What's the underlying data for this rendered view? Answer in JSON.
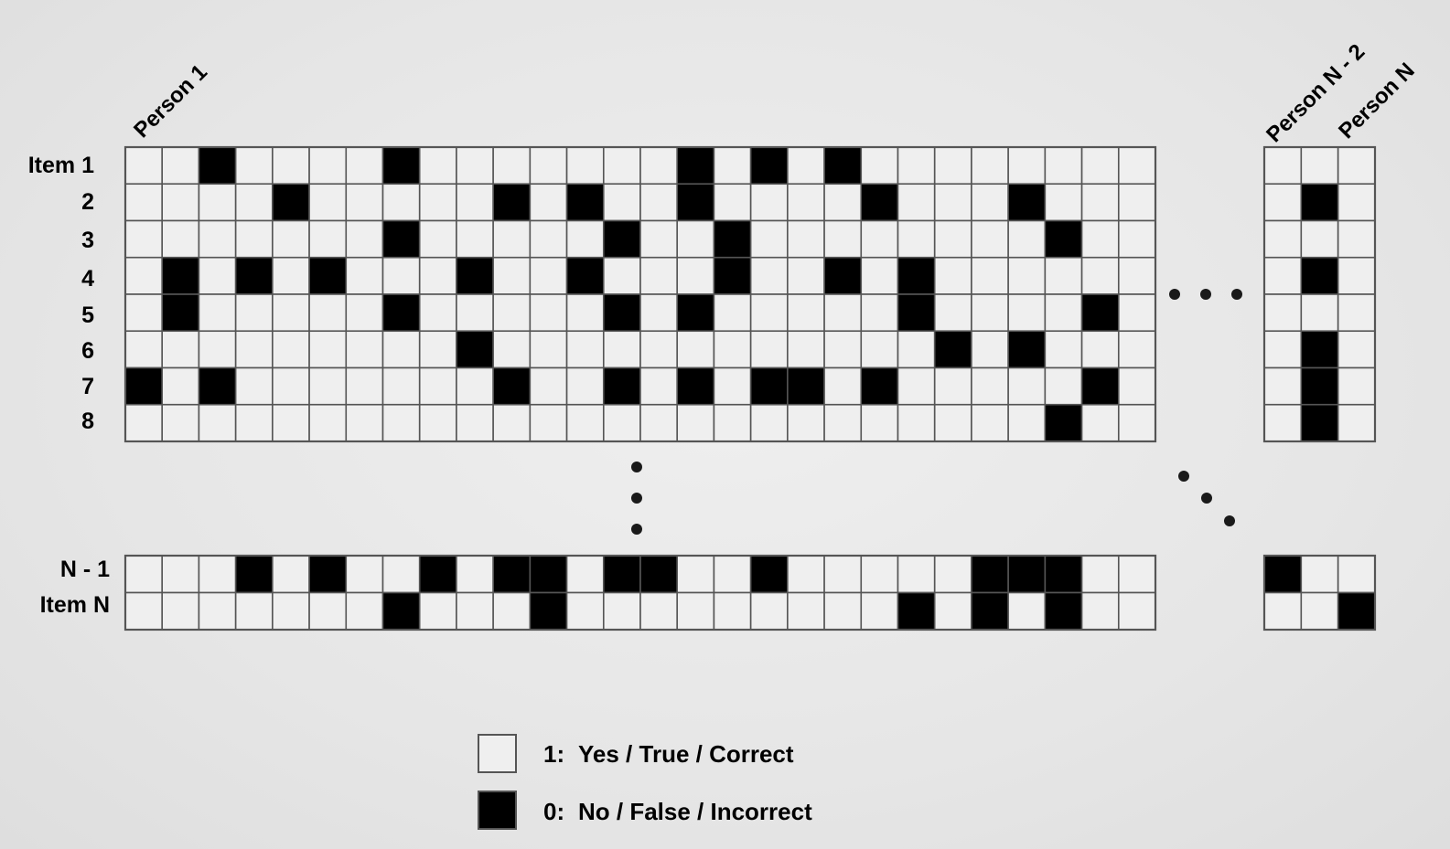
{
  "colors": {
    "cell_one": "#efefef",
    "cell_zero": "#000000",
    "grid_line": "#555555",
    "dot": "#1a1a1a"
  },
  "column_labels": {
    "first": "Person 1",
    "second_last": "Person N - 2",
    "last": "Person N"
  },
  "row_labels": [
    "Item 1",
    "2",
    "3",
    "4",
    "5",
    "6",
    "7",
    "8"
  ],
  "bottom_row_labels": [
    "N - 1",
    "Item N"
  ],
  "matrix": {
    "main_top": [
      [
        1,
        1,
        0,
        1,
        1,
        1,
        1,
        0,
        1,
        1,
        1,
        1,
        1,
        1,
        1,
        0,
        1,
        0,
        1,
        0,
        1,
        1,
        1,
        1,
        1,
        1,
        1,
        1
      ],
      [
        1,
        1,
        1,
        1,
        0,
        1,
        1,
        1,
        1,
        1,
        0,
        1,
        0,
        1,
        1,
        0,
        1,
        1,
        1,
        1,
        0,
        1,
        1,
        1,
        0,
        1,
        1,
        1
      ],
      [
        1,
        1,
        1,
        1,
        1,
        1,
        1,
        0,
        1,
        1,
        1,
        1,
        1,
        0,
        1,
        1,
        0,
        1,
        1,
        1,
        1,
        1,
        1,
        1,
        1,
        0,
        1,
        1
      ],
      [
        1,
        0,
        1,
        0,
        1,
        0,
        1,
        1,
        1,
        0,
        1,
        1,
        0,
        1,
        1,
        1,
        0,
        1,
        1,
        0,
        1,
        0,
        1,
        1,
        1,
        1,
        1,
        1
      ],
      [
        1,
        0,
        1,
        1,
        1,
        1,
        1,
        0,
        1,
        1,
        1,
        1,
        1,
        0,
        1,
        0,
        1,
        1,
        1,
        1,
        1,
        0,
        1,
        1,
        1,
        1,
        0,
        1
      ],
      [
        1,
        1,
        1,
        1,
        1,
        1,
        1,
        1,
        1,
        0,
        1,
        1,
        1,
        1,
        1,
        1,
        1,
        1,
        1,
        1,
        1,
        1,
        0,
        1,
        0,
        1,
        1,
        1
      ],
      [
        0,
        1,
        0,
        1,
        1,
        1,
        1,
        1,
        1,
        1,
        0,
        1,
        1,
        0,
        1,
        0,
        1,
        0,
        0,
        1,
        0,
        1,
        1,
        1,
        1,
        1,
        0,
        1
      ],
      [
        1,
        1,
        1,
        1,
        1,
        1,
        1,
        1,
        1,
        1,
        1,
        1,
        1,
        1,
        1,
        1,
        1,
        1,
        1,
        1,
        1,
        1,
        1,
        1,
        1,
        0,
        1,
        1
      ]
    ],
    "right_top": [
      [
        1,
        1,
        1
      ],
      [
        1,
        0,
        1
      ],
      [
        1,
        1,
        1
      ],
      [
        1,
        0,
        1
      ],
      [
        1,
        1,
        1
      ],
      [
        1,
        0,
        1
      ],
      [
        1,
        0,
        1
      ],
      [
        1,
        0,
        1
      ]
    ],
    "main_bottom": [
      [
        1,
        1,
        1,
        0,
        1,
        0,
        1,
        1,
        0,
        1,
        0,
        0,
        1,
        0,
        0,
        1,
        1,
        0,
        1,
        1,
        1,
        1,
        1,
        0,
        0,
        0,
        1,
        1
      ],
      [
        1,
        1,
        1,
        1,
        1,
        1,
        1,
        0,
        1,
        1,
        1,
        0,
        1,
        1,
        1,
        1,
        1,
        1,
        1,
        1,
        1,
        0,
        1,
        0,
        1,
        0,
        1,
        1
      ]
    ],
    "right_bottom": [
      [
        0,
        1,
        1
      ],
      [
        1,
        1,
        0
      ]
    ]
  },
  "legend": [
    {
      "value": "1:",
      "text": "Yes / True / Correct"
    },
    {
      "value": "0:",
      "text": "No / False / Incorrect"
    }
  ]
}
